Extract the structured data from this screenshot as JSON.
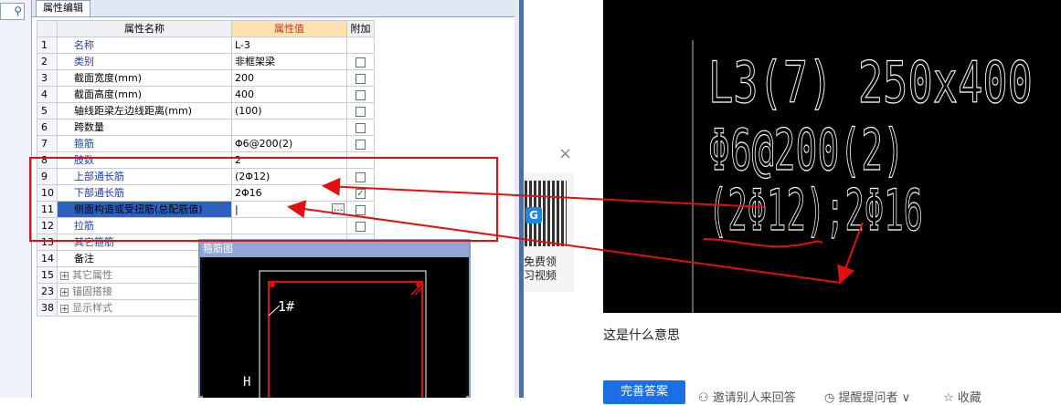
{
  "panel": {
    "tab_label": "属性编辑",
    "columns": [
      "属性名称",
      "属性值",
      "附加"
    ],
    "rows": [
      {
        "num": "1",
        "name": "名称",
        "value": "L-3",
        "checkbox": false,
        "style": "blue"
      },
      {
        "num": "2",
        "name": "类别",
        "value": "非框架梁",
        "checkbox": true,
        "checked": false,
        "style": "blue"
      },
      {
        "num": "3",
        "name": "截面宽度(mm)",
        "value": "200",
        "checkbox": true,
        "checked": false,
        "style": "black"
      },
      {
        "num": "4",
        "name": "截面高度(mm)",
        "value": "400",
        "checkbox": true,
        "checked": false,
        "style": "black"
      },
      {
        "num": "5",
        "name": "轴线距梁左边线距离(mm)",
        "value": "(100)",
        "checkbox": true,
        "checked": false,
        "style": "black"
      },
      {
        "num": "6",
        "name": "跨数量",
        "value": "",
        "checkbox": true,
        "checked": false,
        "style": "black"
      },
      {
        "num": "7",
        "name": "箍筋",
        "value": "Φ6@200(2)",
        "checkbox": true,
        "checked": false,
        "style": "blue"
      },
      {
        "num": "8",
        "name": "肢数",
        "value": "2",
        "checkbox": false,
        "style": "blue"
      },
      {
        "num": "9",
        "name": "上部通长筋",
        "value": "(2Φ12)",
        "checkbox": true,
        "checked": false,
        "style": "blue"
      },
      {
        "num": "10",
        "name": "下部通长筋",
        "value": "2Φ16",
        "checkbox": true,
        "checked": true,
        "style": "blue"
      },
      {
        "num": "11",
        "name": "侧面构造或受扭筋(总配筋值)",
        "value": "",
        "checkbox": true,
        "checked": false,
        "style": "selected"
      },
      {
        "num": "12",
        "name": "拉筋",
        "value": "",
        "checkbox": true,
        "checked": false,
        "style": "blue"
      },
      {
        "num": "13",
        "name": "其它箍筋",
        "value": "",
        "checkbox": false,
        "style": "blue"
      },
      {
        "num": "14",
        "name": "备注",
        "value": "",
        "checkbox": false,
        "style": "black"
      },
      {
        "num": "15",
        "name": "其它属性",
        "value": "",
        "checkbox": false,
        "style": "group"
      },
      {
        "num": "23",
        "name": "锚固搭接",
        "value": "",
        "checkbox": false,
        "style": "group"
      },
      {
        "num": "38",
        "name": "显示样式",
        "value": "",
        "checkbox": false,
        "style": "group"
      }
    ]
  },
  "dialog": {
    "title": "箍筋图",
    "label_1": "1#",
    "label_h": "H"
  },
  "ad": {
    "close_glyph": "×",
    "logo": "G",
    "text_line1": "免费领",
    "text_line2": "习视频"
  },
  "cad": {
    "line1": "L3(7) 250x400",
    "line2": "Φ6@200(2)",
    "line3": "(2Φ12);2Φ16"
  },
  "question": {
    "text": "这是什么意思"
  },
  "actions": {
    "answer": "完善答案",
    "invite": "邀请别人来回答",
    "remind": "提醒提问者",
    "favorite": "收藏"
  },
  "colors": {
    "annotation_red": "#e01010",
    "selected_row": "#2f62c0",
    "value_header": "#fde2b0",
    "answer_button": "#1b6ee3"
  }
}
